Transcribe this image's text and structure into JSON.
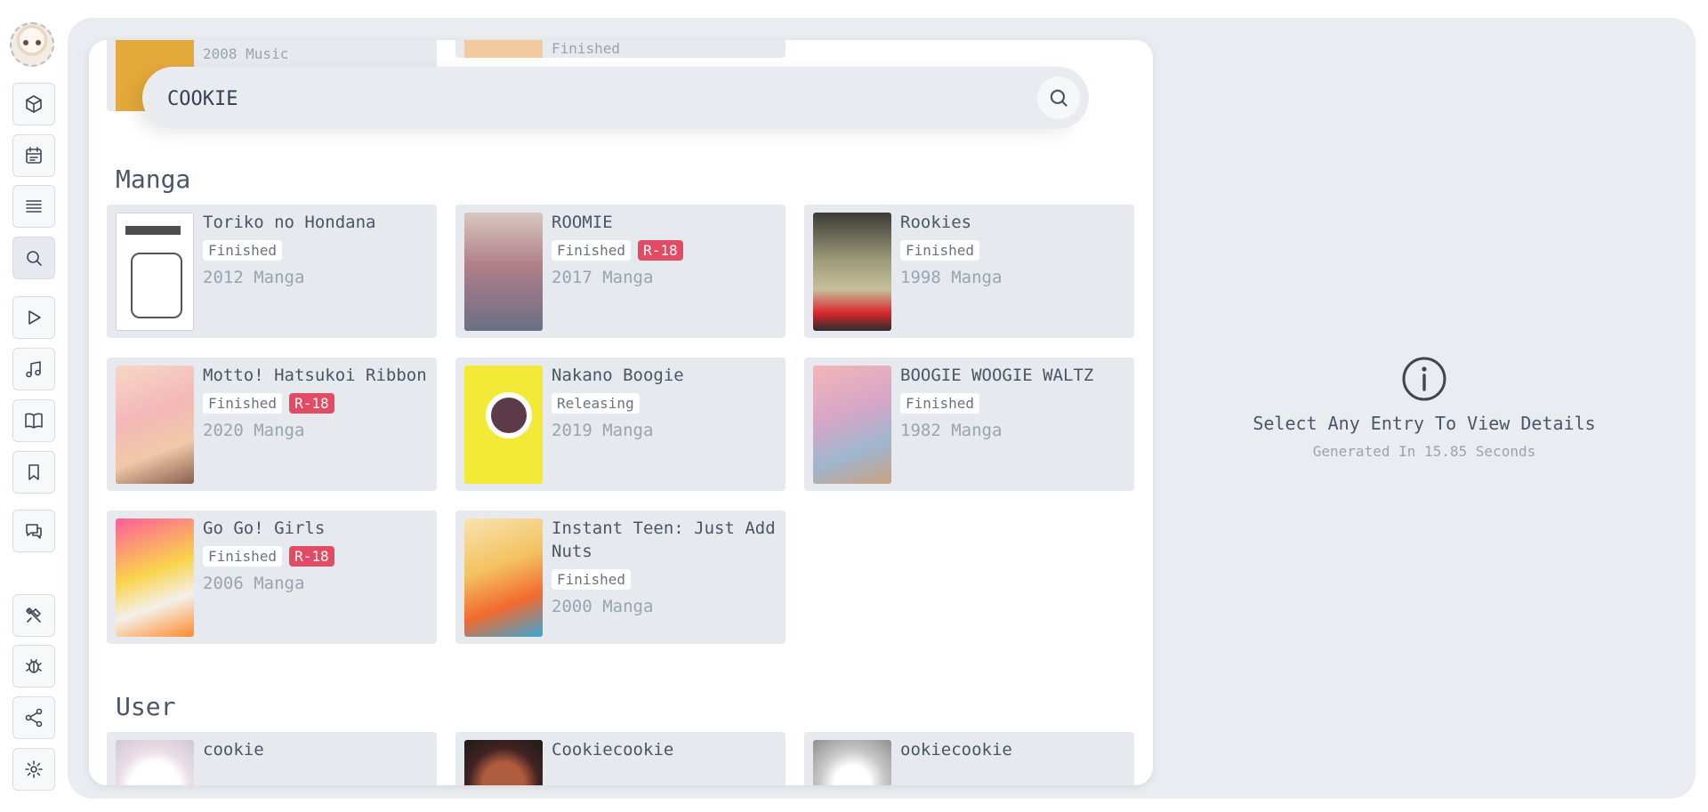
{
  "sidebar": {
    "items": [
      {
        "name": "cube-icon"
      },
      {
        "name": "calendar-icon"
      },
      {
        "name": "list-icon"
      },
      {
        "name": "search-icon",
        "active": true
      },
      {
        "name": "play-icon"
      },
      {
        "name": "music-icon"
      },
      {
        "name": "book-icon"
      },
      {
        "name": "bookmark-icon"
      },
      {
        "name": "chat-icon"
      },
      {
        "name": "tools-icon"
      },
      {
        "name": "bug-icon"
      },
      {
        "name": "share-icon"
      },
      {
        "name": "settings-icon"
      }
    ]
  },
  "peek": {
    "card1_text": "2008 Music",
    "card2_text": "Finished"
  },
  "search": {
    "value": "COOKIE"
  },
  "sections": {
    "manga_title": "Manga",
    "user_title": "User"
  },
  "manga": [
    {
      "title": "Toriko no Hondana",
      "status": "Finished",
      "r18": "",
      "meta": "2012 Manga"
    },
    {
      "title": "ROOMIE",
      "status": "Finished",
      "r18": "R-18",
      "meta": "2017 Manga"
    },
    {
      "title": "Rookies",
      "status": "Finished",
      "r18": "",
      "meta": "1998 Manga"
    },
    {
      "title": "Motto! Hatsukoi Ribbon",
      "status": "Finished",
      "r18": "R-18",
      "meta": "2020 Manga"
    },
    {
      "title": "Nakano Boogie",
      "status": "Releasing",
      "r18": "",
      "meta": "2019 Manga"
    },
    {
      "title": "BOOGIE WOOGIE WALTZ",
      "status": "Finished",
      "r18": "",
      "meta": "1982 Manga"
    },
    {
      "title": "Go Go! Girls",
      "status": "Finished",
      "r18": "R-18",
      "meta": "2006 Manga"
    },
    {
      "title": "Instant Teen: Just Add Nuts",
      "status": "Finished",
      "r18": "",
      "meta": "2000 Manga"
    }
  ],
  "users": [
    {
      "name": "cookie"
    },
    {
      "name": "Cookiecookie"
    },
    {
      "name": "ookiecookie"
    }
  ],
  "details": {
    "title": "Select Any Entry To View Details",
    "subtitle": "Generated In 15.85 Seconds"
  },
  "colors": {
    "accent_r18": "#e14b63",
    "card_bg": "#e6eaef",
    "panel_bg": "#e9ecf0"
  }
}
